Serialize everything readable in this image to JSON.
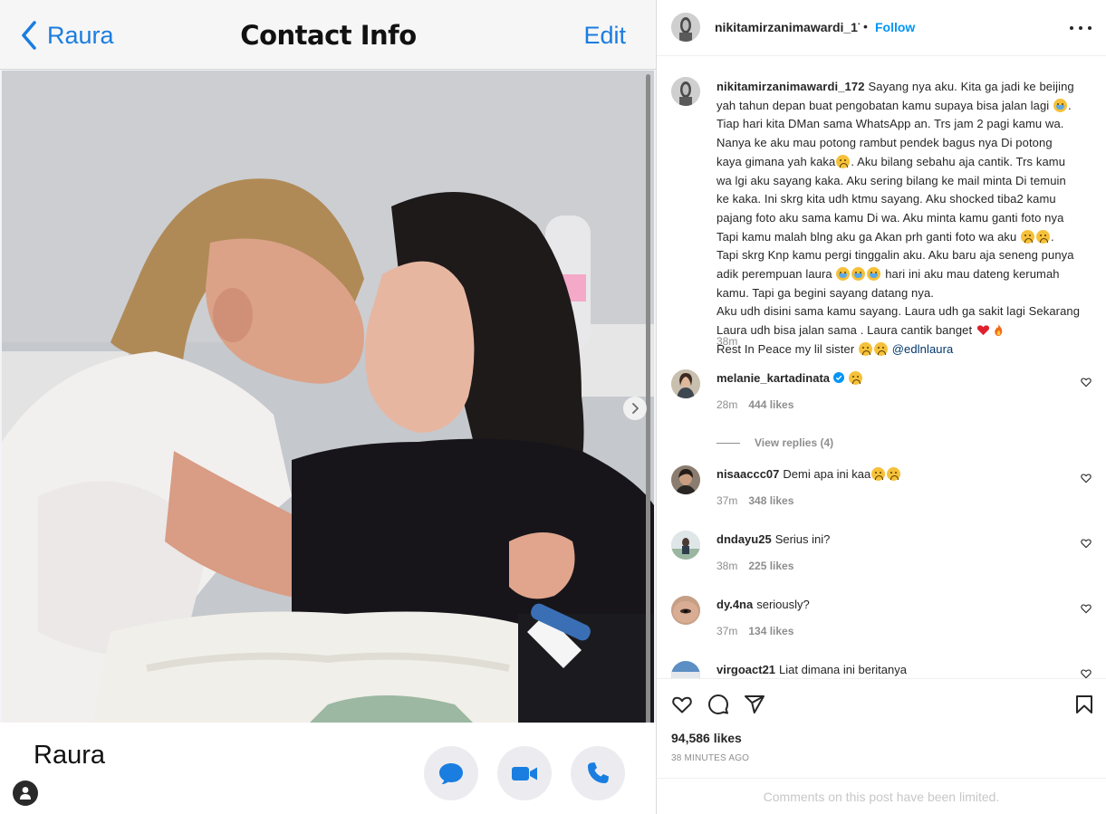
{
  "contact_screen": {
    "back_label": "Raura",
    "title": "Contact Info",
    "edit_label": "Edit",
    "name": "Raura"
  },
  "post": {
    "username": "nikitamirzanimawardi_172",
    "separator": "•",
    "follow_label": "Follow",
    "caption": {
      "username": "nikitamirzanimawardi_172",
      "lines": [
        "Sayang nya aku. Kita ga jadi ke beijing",
        "yah tahun depan buat pengobatan kamu supaya bisa jalan lagi",
        "Tiap hari kita DMan sama WhatsApp an. Trs jam 2 pagi kamu wa.",
        "Nanya ke aku mau potong rambut pendek bagus nya Di potong",
        "kaya gimana yah kaka",
        ". Aku bilang sebahu aja cantik. Trs kamu",
        "wa lgi aku sayang kaka. Aku sering bilang ke mail minta Di temuin",
        "ke kaka. Ini skrg kita udh ktmu sayang. Aku shocked tiba2 kamu",
        "pajang foto aku sama kamu Di wa. Aku minta kamu ganti foto nya",
        "Tapi kamu malah blng aku ga Akan prh ganti foto wa aku",
        "Tapi skrg Knp kamu pergi tinggalin aku. Aku baru aja seneng punya",
        "adik perempuan laura",
        "hari ini aku mau dateng kerumah",
        "kamu. Tapi ga begini sayang datang nya.",
        "Aku udh disini sama kamu sayang. Laura udh ga sakit lagi Sekarang",
        "Laura udh bisa jalan sama . Laura cantik banget",
        "Rest In Peace my lil sister",
        "@edlnlaura"
      ],
      "time": "38m"
    },
    "comments": [
      {
        "username": "melanie_kartadinata",
        "text": "",
        "time": "28m",
        "likes": "444 likes",
        "view_replies": "View replies (4)"
      },
      {
        "username": "nisaaccc07",
        "text": "Demi apa ini kaa",
        "time": "37m",
        "likes": "348 likes"
      },
      {
        "username": "dndayu25",
        "text": "Serius ini?",
        "time": "38m",
        "likes": "225 likes"
      },
      {
        "username": "dy.4na",
        "text": "seriously?",
        "time": "37m",
        "likes": "134 likes"
      },
      {
        "username": "virgoact21",
        "text": "Liat dimana ini beritanya"
      }
    ],
    "likes": "94,586 likes",
    "time_ago": "38 MINUTES AGO",
    "comments_limited": "Comments on this post have been limited."
  },
  "colors": {
    "ios_blue": "#1a7de0",
    "instagram_blue": "#0095f6",
    "verified_blue": "#0095f6",
    "text_primary": "#262626",
    "text_secondary": "#8e8e8e"
  },
  "icons": [
    "back-chevron-icon",
    "message-icon",
    "video-icon",
    "phone-icon",
    "person-icon",
    "more-icon",
    "heart-icon",
    "comment-icon",
    "share-icon",
    "bookmark-icon",
    "next-icon",
    "verified-icon"
  ]
}
